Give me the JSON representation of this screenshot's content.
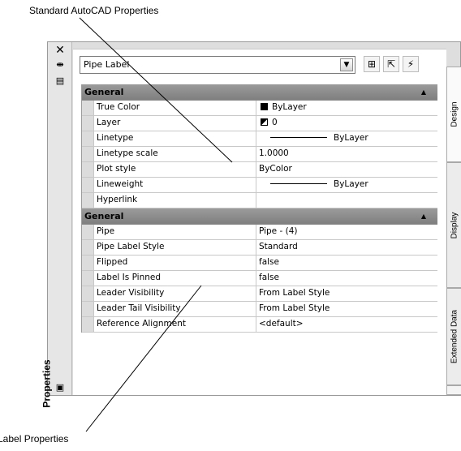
{
  "callouts": {
    "top": "Standard AutoCAD Properties",
    "bottom": "Label Properties"
  },
  "palette": {
    "title": "Properties",
    "selector_value": "Pipe Label",
    "icons": {
      "close": "close-icon",
      "autohide": "autohide-icon",
      "menu": "properties-menu-icon",
      "dropdown": "chevron-down-icon",
      "quick_select": "quick-select-icon",
      "select_objects": "select-objects-icon",
      "pickadd": "pickadd-toggle-icon"
    },
    "tabs": [
      "Design",
      "Display",
      "Extended Data"
    ]
  },
  "categories": [
    {
      "label": "General",
      "rows": [
        {
          "name": "True Color",
          "value": "ByLayer",
          "kind": "color"
        },
        {
          "name": "Layer",
          "value": "0",
          "kind": "layer"
        },
        {
          "name": "Linetype",
          "value": "ByLayer",
          "kind": "line"
        },
        {
          "name": "Linetype scale",
          "value": "1.0000",
          "kind": "text"
        },
        {
          "name": "Plot style",
          "value": "ByColor",
          "kind": "text"
        },
        {
          "name": "Lineweight",
          "value": "ByLayer",
          "kind": "line"
        },
        {
          "name": "Hyperlink",
          "value": "",
          "kind": "text"
        }
      ]
    },
    {
      "label": "General",
      "rows": [
        {
          "name": "Pipe",
          "value": "Pipe - (4)",
          "kind": "text"
        },
        {
          "name": "Pipe Label Style",
          "value": "Standard",
          "kind": "text"
        },
        {
          "name": "Flipped",
          "value": "false",
          "kind": "text"
        },
        {
          "name": "Label Is Pinned",
          "value": "false",
          "kind": "text"
        },
        {
          "name": "Leader Visibility",
          "value": "From Label Style",
          "kind": "text"
        },
        {
          "name": "Leader Tail Visibility",
          "value": "From Label Style",
          "kind": "text"
        },
        {
          "name": "Reference Alignment",
          "value": "<default>",
          "kind": "text"
        }
      ]
    }
  ]
}
